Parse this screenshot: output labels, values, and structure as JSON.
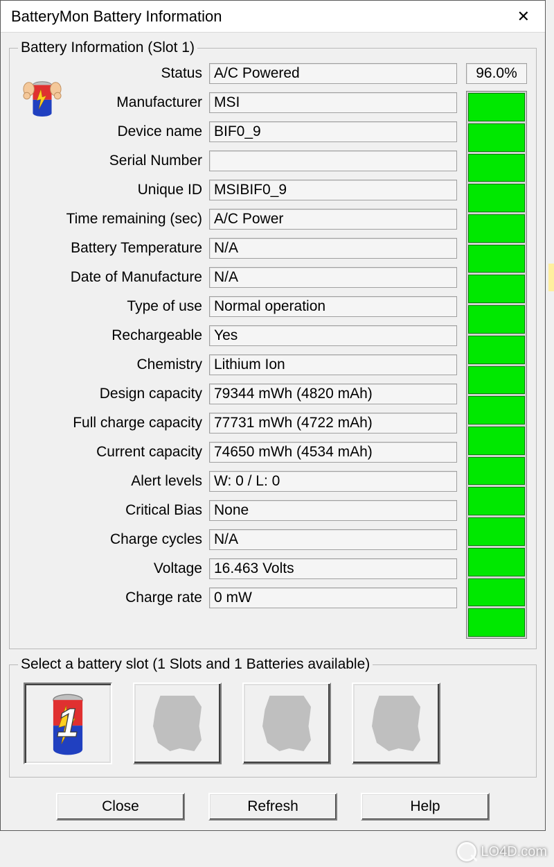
{
  "window": {
    "title": "BatteryMon Battery Information"
  },
  "group_info": {
    "legend": "Battery Information (Slot 1)",
    "meter_percent": "96.0%",
    "meter_segments": 18,
    "fields": [
      {
        "label": "Status",
        "value": "A/C Powered"
      },
      {
        "label": "Manufacturer",
        "value": "MSI"
      },
      {
        "label": "Device name",
        "value": "BIF0_9"
      },
      {
        "label": "Serial Number",
        "value": ""
      },
      {
        "label": "Unique ID",
        "value": "MSIBIF0_9"
      },
      {
        "label": "Time remaining (sec)",
        "value": "A/C Power"
      },
      {
        "label": "Battery Temperature",
        "value": "N/A"
      },
      {
        "label": "Date of Manufacture",
        "value": "N/A"
      },
      {
        "label": "Type of use",
        "value": "Normal operation"
      },
      {
        "label": "Rechargeable",
        "value": "Yes"
      },
      {
        "label": "Chemistry",
        "value": "Lithium Ion"
      },
      {
        "label": "Design capacity",
        "value": "79344 mWh (4820 mAh)"
      },
      {
        "label": "Full charge capacity",
        "value": "77731 mWh (4722 mAh)"
      },
      {
        "label": "Current capacity",
        "value": "74650 mWh (4534 mAh)"
      },
      {
        "label": "Alert levels",
        "value": "W: 0 / L: 0"
      },
      {
        "label": "Critical Bias",
        "value": "None"
      },
      {
        "label": "Charge cycles",
        "value": "N/A"
      },
      {
        "label": "Voltage",
        "value": "16.463 Volts"
      },
      {
        "label": "Charge rate",
        "value": "0 mW"
      }
    ]
  },
  "group_slots": {
    "legend": "Select a battery slot (1 Slots and 1 Batteries available)",
    "slots": [
      {
        "active": true,
        "number": "1"
      },
      {
        "active": false
      },
      {
        "active": false
      },
      {
        "active": false
      }
    ]
  },
  "buttons": {
    "close": "Close",
    "refresh": "Refresh",
    "help": "Help"
  },
  "watermark": "LO4D.com"
}
